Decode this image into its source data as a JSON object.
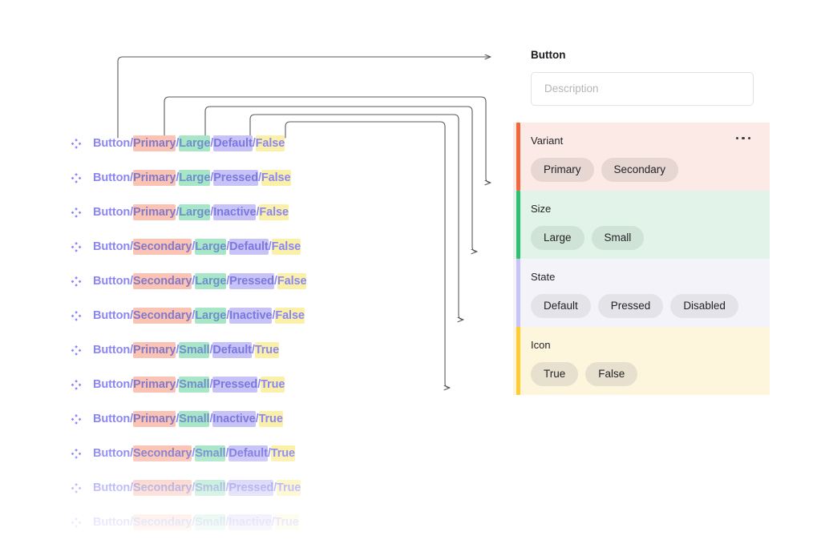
{
  "panel": {
    "title": "Button",
    "description_value": "",
    "description_placeholder": "Description",
    "overflow_icon": "more-horizontal-icon",
    "groups": [
      {
        "name": "Variant",
        "accent": "#F4663C",
        "background": "#FCEAE6",
        "values": [
          "Primary",
          "Secondary"
        ],
        "has_menu": true
      },
      {
        "name": "Size",
        "accent": "#2FBF71",
        "background": "#E2F3E9",
        "values": [
          "Large",
          "Small"
        ],
        "has_menu": false
      },
      {
        "name": "State",
        "accent": "#C7C3F7",
        "background": "#F4F3FA",
        "values": [
          "Default",
          "Pressed",
          "Disabled"
        ],
        "has_menu": false
      },
      {
        "name": "Icon",
        "accent": "#FFCC33",
        "background": "#FDF5DC",
        "values": [
          "True",
          "False"
        ],
        "has_menu": false
      }
    ]
  },
  "layer_list": {
    "icon": "figma-component-icon",
    "separator": "/",
    "base_name": "Button",
    "rows": [
      {
        "base": "Button",
        "variant": "Primary",
        "size": "Large",
        "state": "Default",
        "icon": "False",
        "opacity": 1.0
      },
      {
        "base": "Button",
        "variant": "Primary",
        "size": "Large",
        "state": "Pressed",
        "icon": "False",
        "opacity": 1.0
      },
      {
        "base": "Button",
        "variant": "Primary",
        "size": "Large",
        "state": "Inactive",
        "icon": "False",
        "opacity": 1.0
      },
      {
        "base": "Button",
        "variant": "Secondary",
        "size": "Large",
        "state": "Default",
        "icon": "False",
        "opacity": 1.0
      },
      {
        "base": "Button",
        "variant": "Secondary",
        "size": "Large",
        "state": "Pressed",
        "icon": "False",
        "opacity": 1.0
      },
      {
        "base": "Button",
        "variant": "Secondary",
        "size": "Large",
        "state": "Inactive",
        "icon": "False",
        "opacity": 1.0
      },
      {
        "base": "Button",
        "variant": "Primary",
        "size": "Small",
        "state": "Default",
        "icon": "True",
        "opacity": 1.0
      },
      {
        "base": "Button",
        "variant": "Primary",
        "size": "Small",
        "state": "Pressed",
        "icon": "True",
        "opacity": 1.0
      },
      {
        "base": "Button",
        "variant": "Primary",
        "size": "Small",
        "state": "Inactive",
        "icon": "True",
        "opacity": 1.0
      },
      {
        "base": "Button",
        "variant": "Secondary",
        "size": "Small",
        "state": "Default",
        "icon": "True",
        "opacity": 1.0
      },
      {
        "base": "Button",
        "variant": "Secondary",
        "size": "Small",
        "state": "Pressed",
        "icon": "True",
        "opacity": 1.0
      },
      {
        "base": "Button",
        "variant": "Secondary",
        "size": "Small",
        "state": "Inactive",
        "icon": "True",
        "opacity": 1.0
      }
    ]
  },
  "connectors": {
    "stroke": "#5a5a5e",
    "arrow_targets": [
      "Variant",
      "Size",
      "State",
      "Icon"
    ],
    "count": 4
  },
  "colors": {
    "layer_text": "#8B86F5",
    "highlight_variant": "#FBC3B4",
    "highlight_size": "#A8E6C8",
    "highlight_state": "#C8C3F7",
    "highlight_icon": "#FBF0A8",
    "panel_title": "#1b1b1f",
    "placeholder": "#b6b6ba"
  }
}
